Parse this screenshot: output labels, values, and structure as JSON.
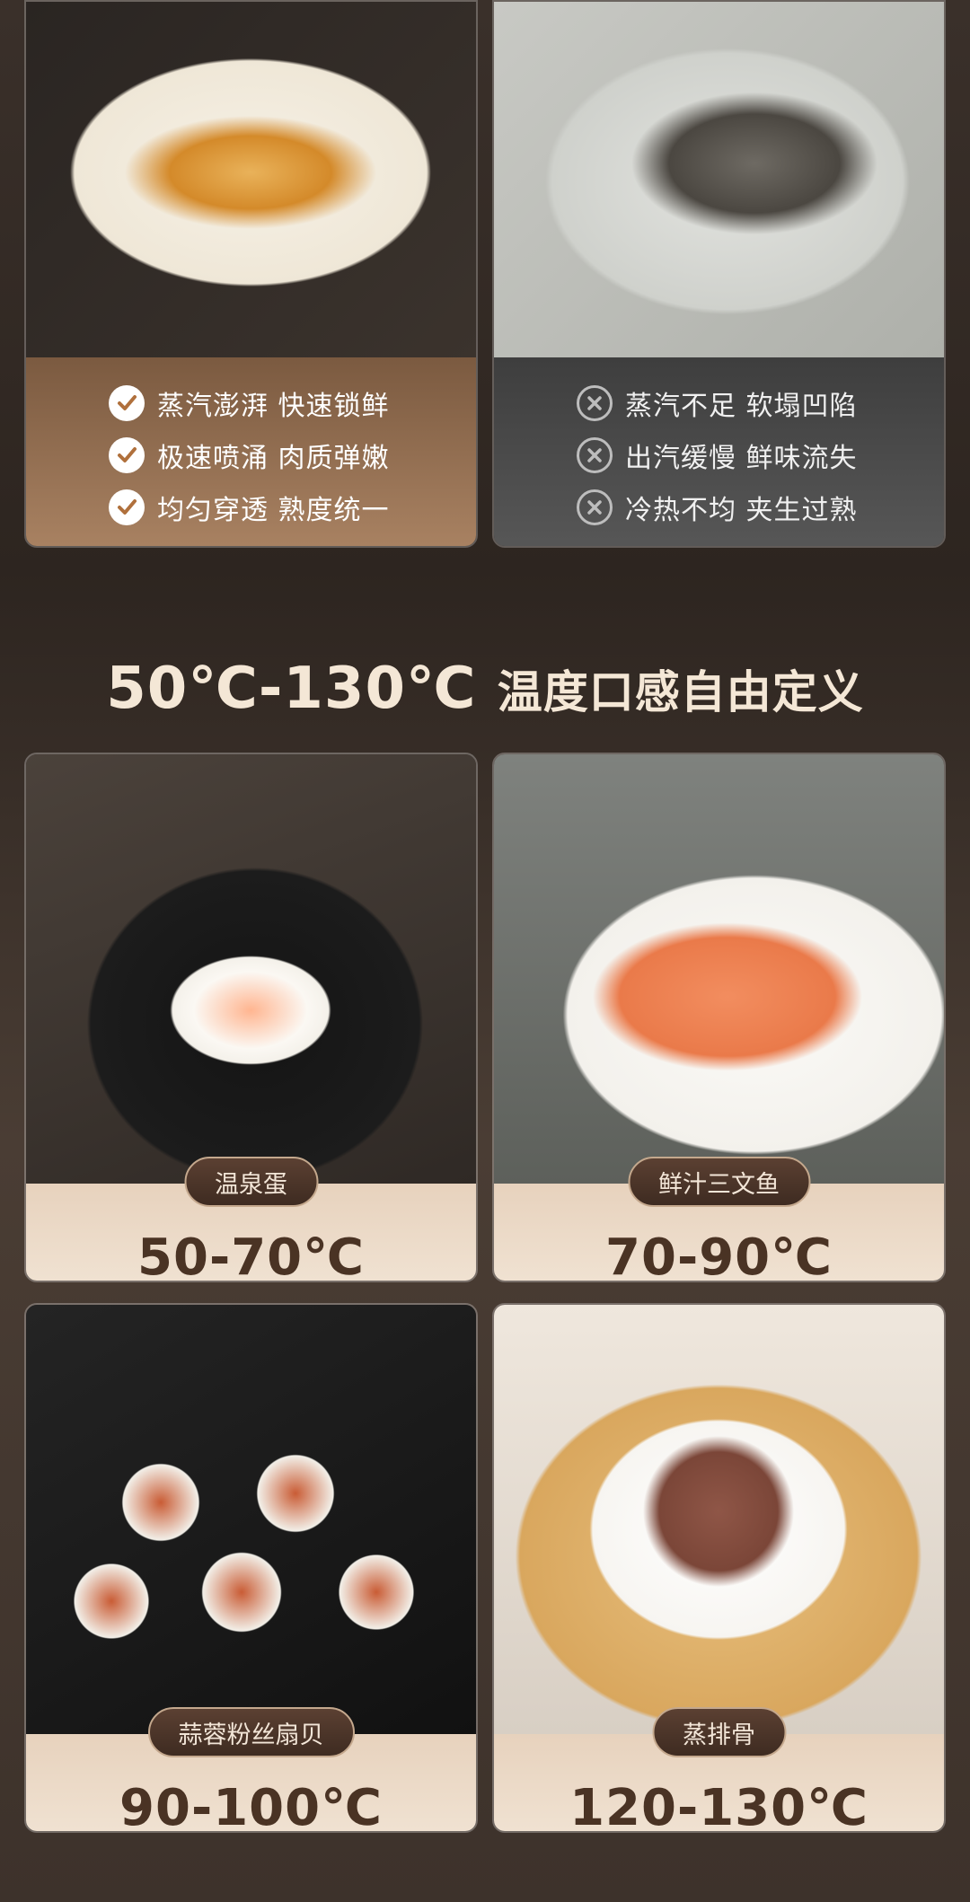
{
  "compare": {
    "good": {
      "items": [
        "蒸汽澎湃 快速锁鲜",
        "极速喷涌 肉质弹嫩",
        "均匀穿透 熟度统一"
      ],
      "icon": "check-circle-icon"
    },
    "bad": {
      "items": [
        "蒸汽不足 软塌凹陷",
        "出汽缓慢 鲜味流失",
        "冷热不均 夹生过熟"
      ],
      "icon": "x-circle-icon"
    }
  },
  "headline": {
    "range": "50℃-130℃",
    "text": "温度口感自由定义"
  },
  "cards": [
    {
      "name": "温泉蛋",
      "temp": "50-70℃"
    },
    {
      "name": "鲜汁三文鱼",
      "temp": "70-90℃"
    },
    {
      "name": "蒜蓉粉丝扇贝",
      "temp": "90-100℃"
    },
    {
      "name": "蒸排骨",
      "temp": "120-130℃"
    }
  ],
  "colors": {
    "accent_text": "#f4e7d6",
    "temp_text": "#4a3324",
    "pill_bg": "#4a3428"
  }
}
